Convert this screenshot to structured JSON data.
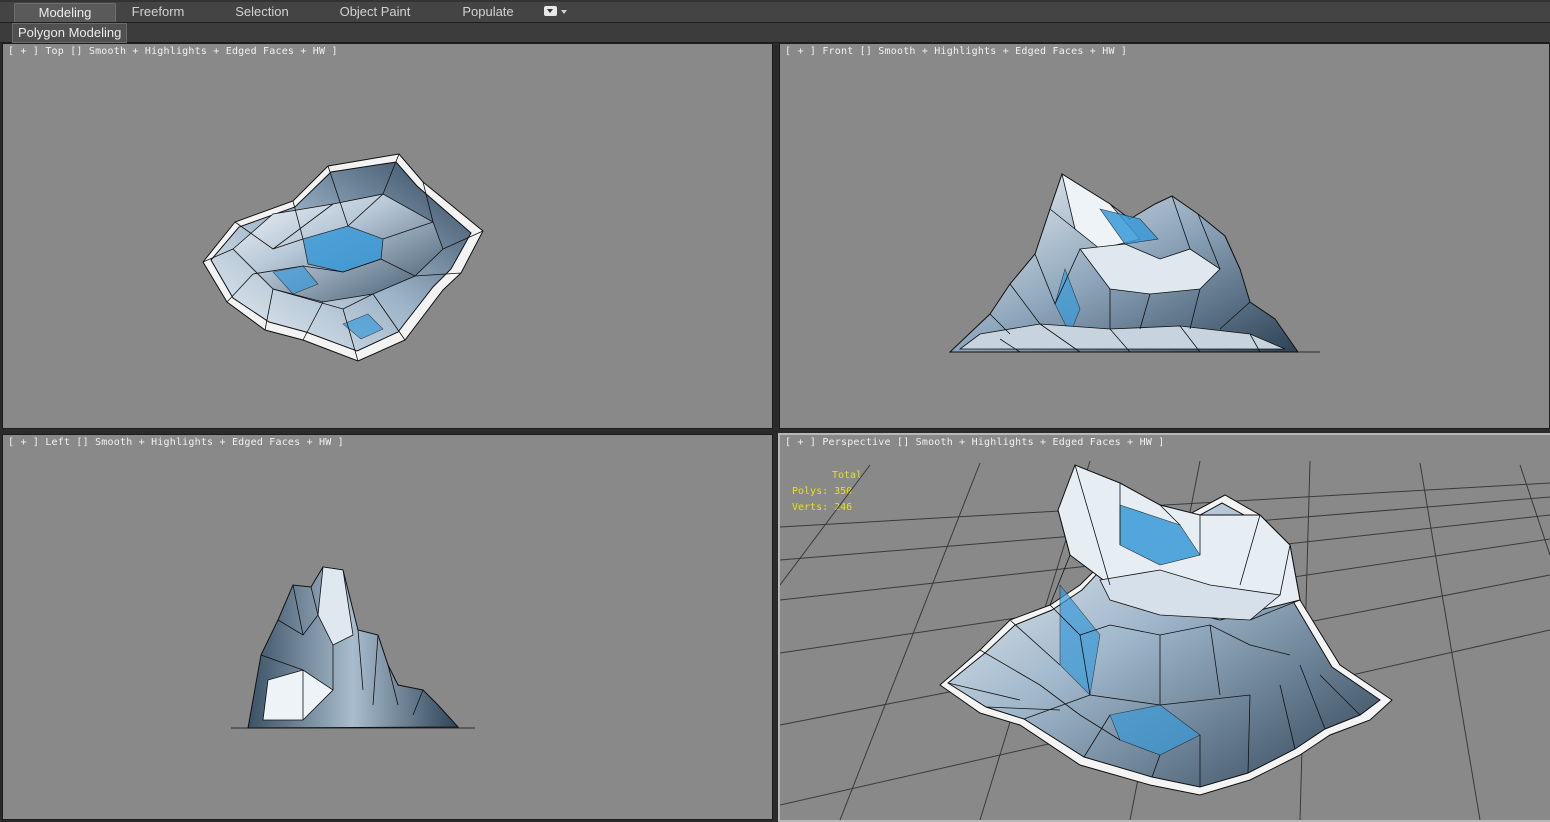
{
  "ribbon": {
    "tabs": [
      {
        "label": "Modeling",
        "active": true
      },
      {
        "label": "Freeform"
      },
      {
        "label": "Selection"
      },
      {
        "label": "Object Paint"
      },
      {
        "label": "Populate"
      }
    ],
    "panel_label": "Polygon Modeling",
    "dropdown_icon": "chevron-down-icon"
  },
  "viewports": {
    "top": {
      "label": "[ + ] Top [] Smooth + Highlights + Edged Faces + HW ]"
    },
    "front": {
      "label": "[ + ] Front [] Smooth + Highlights + Edged Faces + HW ]"
    },
    "left": {
      "label": "[ + ] Left [] Smooth + Highlights + Edged Faces + HW ]"
    },
    "perspective": {
      "label": "[ + ] Perspective [] Smooth + Highlights + Edged Faces + HW ]"
    }
  },
  "stats": {
    "total_label": "Total",
    "polys": "Polys: 350",
    "verts": "Verts: 246"
  },
  "colors": {
    "viewport_bg": "#898989",
    "ice_white": "#e8eef4",
    "ice_blue": "#3a9ad8",
    "ice_dark": "#34495e",
    "stats_text": "#e6e600"
  }
}
